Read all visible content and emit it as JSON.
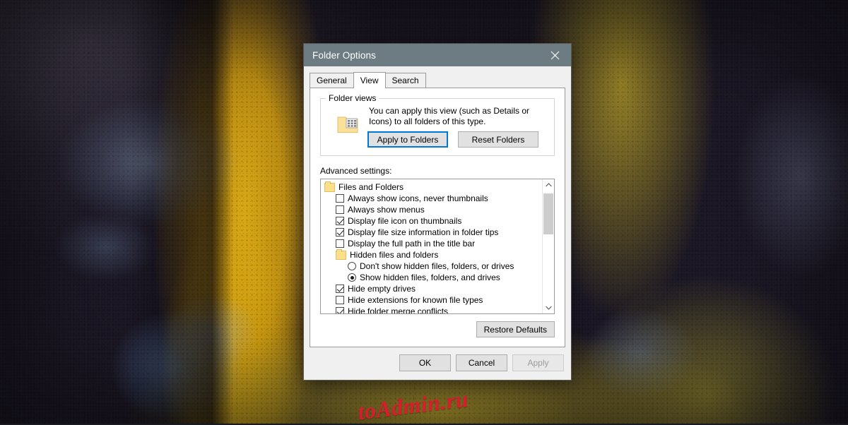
{
  "window": {
    "title": "Folder Options",
    "close_icon": "close-icon"
  },
  "tabs": [
    {
      "label": "General",
      "active": false
    },
    {
      "label": "View",
      "active": true
    },
    {
      "label": "Search",
      "active": false
    }
  ],
  "folder_views": {
    "legend": "Folder views",
    "icon": "folder-view-icon",
    "description": "You can apply this view (such as Details or Icons) to all folders of this type.",
    "apply_button": "Apply to Folders",
    "reset_button": "Reset Folders"
  },
  "advanced": {
    "label": "Advanced settings:",
    "items": [
      {
        "type": "folder",
        "indent": 0,
        "label": "Files and Folders"
      },
      {
        "type": "checkbox",
        "indent": 1,
        "label": "Always show icons, never thumbnails",
        "checked": false
      },
      {
        "type": "checkbox",
        "indent": 1,
        "label": "Always show menus",
        "checked": false
      },
      {
        "type": "checkbox",
        "indent": 1,
        "label": "Display file icon on thumbnails",
        "checked": true
      },
      {
        "type": "checkbox",
        "indent": 1,
        "label": "Display file size information in folder tips",
        "checked": true
      },
      {
        "type": "checkbox",
        "indent": 1,
        "label": "Display the full path in the title bar",
        "checked": false
      },
      {
        "type": "folder",
        "indent": 1,
        "label": "Hidden files and folders"
      },
      {
        "type": "radio",
        "indent": 2,
        "label": "Don't show hidden files, folders, or drives",
        "checked": false
      },
      {
        "type": "radio",
        "indent": 2,
        "label": "Show hidden files, folders, and drives",
        "checked": true
      },
      {
        "type": "checkbox",
        "indent": 1,
        "label": "Hide empty drives",
        "checked": true
      },
      {
        "type": "checkbox",
        "indent": 1,
        "label": "Hide extensions for known file types",
        "checked": false
      },
      {
        "type": "checkbox",
        "indent": 1,
        "label": "Hide folder merge conflicts",
        "checked": true
      }
    ],
    "scrollbar": {
      "up_arrow_icon": "chevron-up-icon",
      "down_arrow_icon": "chevron-down-icon"
    }
  },
  "restore_defaults_button": "Restore Defaults",
  "footer": {
    "ok_button": "OK",
    "cancel_button": "Cancel",
    "apply_button": "Apply",
    "apply_disabled": true
  },
  "watermark": "toAdmin.ru",
  "colors": {
    "titlebar": "#6d7b83",
    "dialog_face": "#f0f0f0",
    "panel": "#ffffff",
    "focus_ring": "#0078d7",
    "watermark": "#e41a30",
    "folder_yellow": "#fbdf8a"
  }
}
